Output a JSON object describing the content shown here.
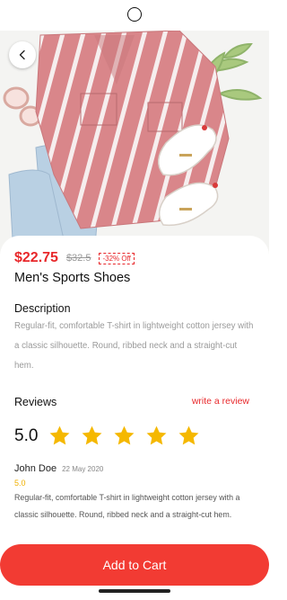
{
  "product": {
    "price": "$22.75",
    "old_price": "$32.5",
    "discount": "-32% Off",
    "title": "Men's Sports Shoes"
  },
  "description": {
    "title": "Description",
    "text": "Regular-fit, comfortable T-shirt in lightweight cotton jersey with a classic silhouette. Round, ribbed neck and a straight-cut hem."
  },
  "reviews": {
    "title": "Reviews",
    "write_label": "write a review",
    "rating": "5.0",
    "stars": 5,
    "items": [
      {
        "name": "John Doe",
        "date": "22 May 2020",
        "score": "5.0",
        "text": "Regular-fit, comfortable T-shirt in lightweight cotton jersey with a classic silhouette. Round, ribbed neck and a straight-cut hem."
      }
    ]
  },
  "cta": {
    "add_to_cart": "Add to Cart"
  },
  "icons": {
    "back": "chevron-left-icon",
    "star": "star-icon"
  },
  "colors": {
    "accent": "#f23b33",
    "price": "#e8282b",
    "star": "#f5b800"
  }
}
